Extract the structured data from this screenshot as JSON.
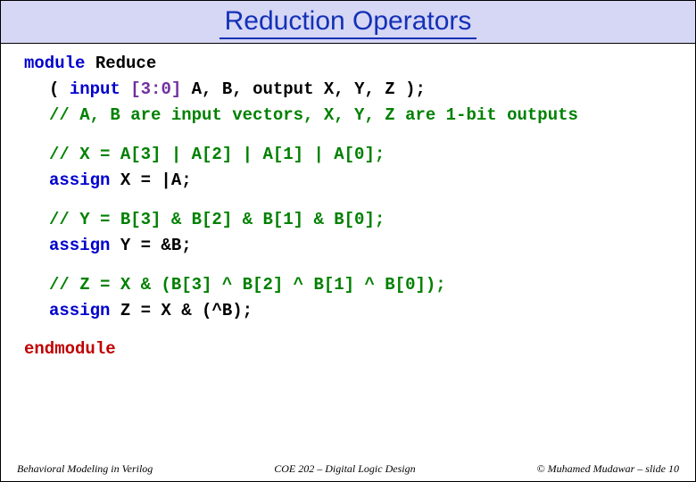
{
  "title": "Reduction Operators",
  "code": {
    "l1a": "module",
    "l1b": " Reduce",
    "l2a": "( ",
    "l2b": "input ",
    "l2c": "[3:0]",
    "l2d": " A, B, output X, Y, Z );",
    "l3": "// A, B are input vectors, X, Y, Z are 1-bit outputs",
    "l4": "// X = A[3] | A[2] | A[1] | A[0];",
    "l5a": "assign",
    "l5b": " X = |A;",
    "l6": "// Y = B[3] & B[2] & B[1] & B[0];",
    "l7a": "assign",
    "l7b": " Y = &B;",
    "l8": "// Z = X & (B[3] ^ B[2] ^ B[1] ^ B[0]);",
    "l9a": "assign",
    "l9b": " Z = X & (^B);",
    "l10": "endmodule"
  },
  "footer": {
    "left": "Behavioral Modeling in Verilog",
    "center": "COE 202 – Digital Logic Design",
    "right": "© Muhamed Mudawar – slide 10"
  }
}
